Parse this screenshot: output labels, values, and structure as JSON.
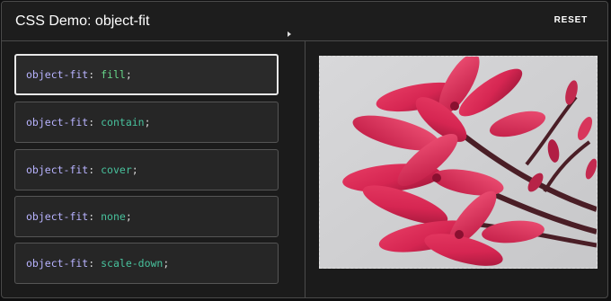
{
  "header": {
    "title": "CSS Demo: object-fit",
    "reset_label": "RESET"
  },
  "options": [
    {
      "property": "object-fit",
      "colon": ":",
      "value": "fill",
      "semicolon": ";",
      "selected": true
    },
    {
      "property": "object-fit",
      "colon": ":",
      "value": "contain",
      "semicolon": ";",
      "selected": false
    },
    {
      "property": "object-fit",
      "colon": ":",
      "value": "cover",
      "semicolon": ";",
      "selected": false
    },
    {
      "property": "object-fit",
      "colon": ":",
      "value": "none",
      "semicolon": ";",
      "selected": false
    },
    {
      "property": "object-fit",
      "colon": ":",
      "value": "scale-down",
      "semicolon": ";",
      "selected": false
    }
  ],
  "preview": {
    "image_subject": "pink-frangipani-flowers",
    "background_color": "#cfcfd0"
  },
  "colors": {
    "property": "#b8b3ff",
    "value": "#48c29d",
    "panel": "#1b1b1b",
    "border": "#4a4a4a"
  }
}
